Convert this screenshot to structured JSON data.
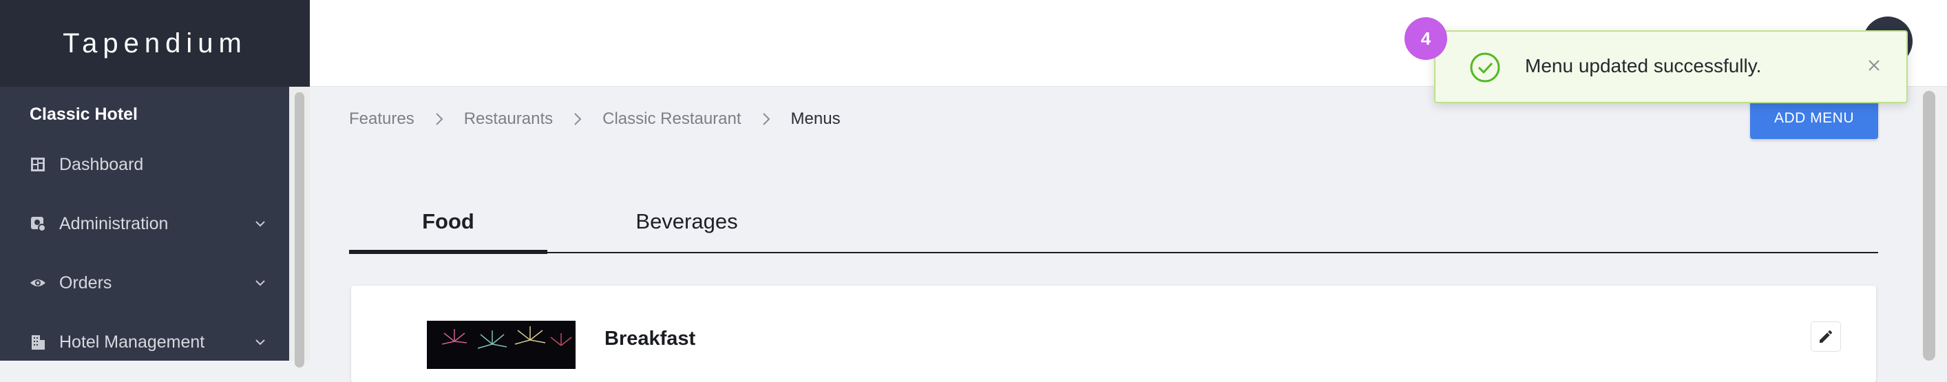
{
  "app": {
    "brand": "Tapendium"
  },
  "sidebar": {
    "hotel_name": "Classic Hotel",
    "items": [
      {
        "label": "Dashboard",
        "icon": "dashboard-icon",
        "expandable": false
      },
      {
        "label": "Administration",
        "icon": "admin-icon",
        "expandable": true
      },
      {
        "label": "Orders",
        "icon": "eye-icon",
        "expandable": true
      },
      {
        "label": "Hotel Management",
        "icon": "building-icon",
        "expandable": true
      }
    ]
  },
  "breadcrumb": {
    "items": [
      "Features",
      "Restaurants",
      "Classic Restaurant",
      "Menus"
    ]
  },
  "toolbar": {
    "add_menu_label": "ADD MENU"
  },
  "tabs": [
    {
      "label": "Food",
      "active": true
    },
    {
      "label": "Beverages",
      "active": false
    }
  ],
  "menus": [
    {
      "title": "Breakfast",
      "image": "fireworks-image"
    }
  ],
  "toast": {
    "message": "Menu updated successfully.",
    "type": "success",
    "badge": "4"
  },
  "colors": {
    "sidebar_bg": "#323848",
    "brand_bg": "#272c38",
    "accent": "#3f7de8",
    "toast_bg": "#f3fae9",
    "toast_border": "#bde08c",
    "success": "#52b823",
    "badge": "#c55ee8"
  }
}
